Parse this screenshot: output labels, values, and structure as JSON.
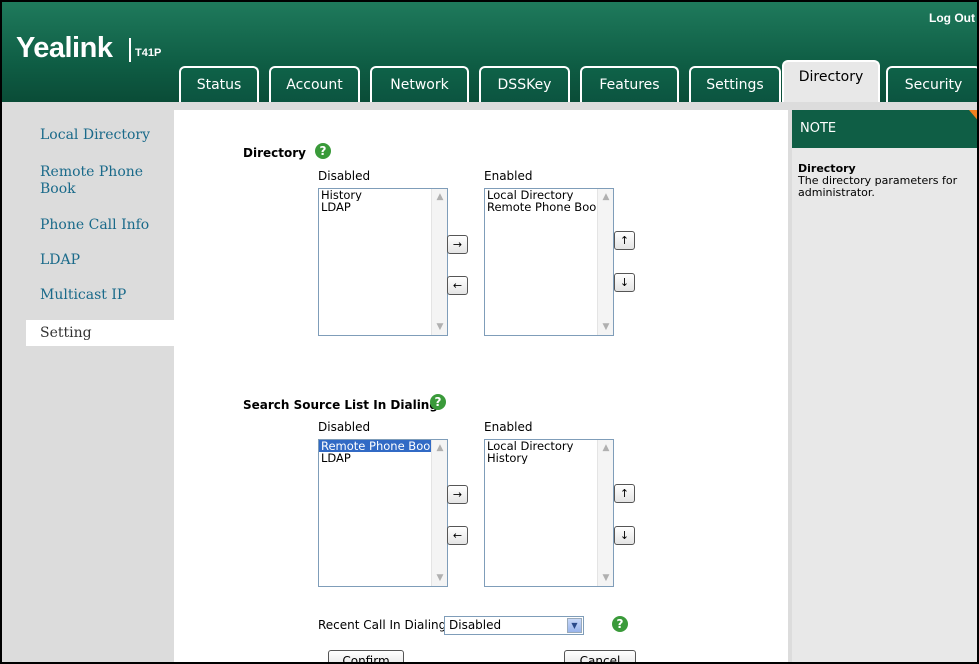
{
  "header": {
    "logo": "Yealink",
    "model": "T41P",
    "logout": "Log Out",
    "tabs": [
      {
        "label": "Status"
      },
      {
        "label": "Account"
      },
      {
        "label": "Network"
      },
      {
        "label": "DSSKey"
      },
      {
        "label": "Features"
      },
      {
        "label": "Settings"
      },
      {
        "label": "Directory"
      },
      {
        "label": "Security"
      }
    ],
    "active_tab": "Directory"
  },
  "sidebar": {
    "items": [
      {
        "label": "Local Directory"
      },
      {
        "label": "Remote Phone Book"
      },
      {
        "label": "Phone Call Info"
      },
      {
        "label": "LDAP"
      },
      {
        "label": "Multicast IP"
      },
      {
        "label": "Setting"
      }
    ],
    "active_item": "Setting"
  },
  "directory": {
    "title": "Directory",
    "disabled_label": "Disabled",
    "enabled_label": "Enabled",
    "disabled_items": [
      "History",
      "LDAP"
    ],
    "enabled_items": [
      "Local Directory",
      "Remote Phone Book"
    ]
  },
  "search_source": {
    "title": "Search Source List In Dialing",
    "disabled_label": "Disabled",
    "enabled_label": "Enabled",
    "disabled_items": [
      "Remote Phone Book",
      "LDAP"
    ],
    "selected_disabled_item": "Remote Phone Book",
    "enabled_items": [
      "Local Directory",
      "History"
    ]
  },
  "recent_call": {
    "label": "Recent Call In Dialing",
    "value": "Disabled"
  },
  "buttons": {
    "move_right": "→",
    "move_left": "←",
    "move_up": "↑",
    "move_down": "↓",
    "confirm": "Confirm",
    "cancel": "Cancel"
  },
  "note": {
    "header": "NOTE",
    "title": "Directory",
    "text": "The directory parameters for administrator."
  },
  "colors": {
    "brand_green": "#0f5e45",
    "link_blue": "#1a6a8a",
    "help_green": "#3a9a3a",
    "note_corner": "#f08020",
    "selection": "#316ac5"
  }
}
